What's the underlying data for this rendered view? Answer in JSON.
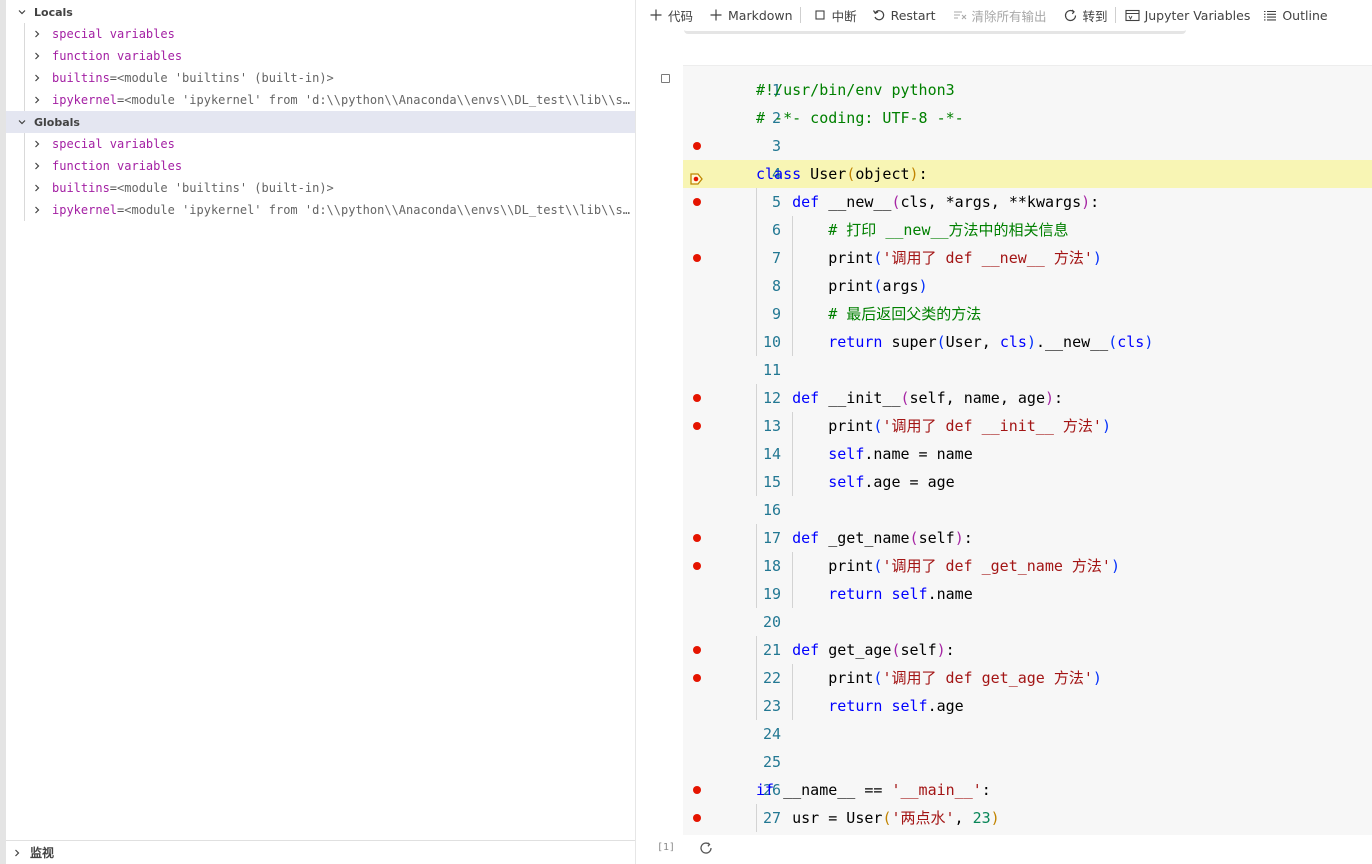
{
  "variables_panel": {
    "locals": {
      "title": "Locals",
      "items": [
        {
          "name": "special variables",
          "eq": "",
          "value": ""
        },
        {
          "name": "function variables",
          "eq": "",
          "value": ""
        },
        {
          "name": "builtins",
          "eq": " = ",
          "value": "<module 'builtins' (built-in)>"
        },
        {
          "name": "ipykernel",
          "eq": " = ",
          "value": "<module 'ipykernel' from 'd:\\\\python\\\\Anaconda\\\\envs\\\\DL_test\\\\lib\\\\s..."
        }
      ]
    },
    "globals": {
      "title": "Globals",
      "items": [
        {
          "name": "special variables",
          "eq": "",
          "value": ""
        },
        {
          "name": "function variables",
          "eq": "",
          "value": ""
        },
        {
          "name": "builtins",
          "eq": " = ",
          "value": "<module 'builtins' (built-in)>"
        },
        {
          "name": "ipykernel",
          "eq": " = ",
          "value": "<module 'ipykernel' from 'd:\\\\python\\\\Anaconda\\\\envs\\\\DL_test\\\\lib\\\\s..."
        }
      ]
    },
    "watch_title": "监视"
  },
  "toolbar": {
    "code_label": "代码",
    "markdown_label": "Markdown",
    "interrupt_label": "中断",
    "restart_label": "Restart",
    "clear_outputs_label": "清除所有输出",
    "goto_label": "转到",
    "jupyter_variables_label": "Jupyter Variables",
    "outline_label": "Outline"
  },
  "cell": {
    "execution_count": "[1]",
    "current_line": 4,
    "breakpoint_lines": [
      3,
      5,
      7,
      12,
      13,
      17,
      18,
      21,
      22,
      26,
      27
    ],
    "lines": [
      {
        "n": "1"
      },
      {
        "n": "2"
      },
      {
        "n": "3"
      },
      {
        "n": "4"
      },
      {
        "n": "5"
      },
      {
        "n": "6"
      },
      {
        "n": "7"
      },
      {
        "n": "8"
      },
      {
        "n": "9"
      },
      {
        "n": "10"
      },
      {
        "n": "11"
      },
      {
        "n": "12"
      },
      {
        "n": "13"
      },
      {
        "n": "14"
      },
      {
        "n": "15"
      },
      {
        "n": "16"
      },
      {
        "n": "17"
      },
      {
        "n": "18"
      },
      {
        "n": "19"
      },
      {
        "n": "20"
      },
      {
        "n": "21"
      },
      {
        "n": "22"
      },
      {
        "n": "23"
      },
      {
        "n": "24"
      },
      {
        "n": "25"
      },
      {
        "n": "26"
      },
      {
        "n": "27"
      }
    ],
    "code": [
      [
        [
          "com",
          "#!/usr/bin/env python3"
        ]
      ],
      [
        [
          "com",
          "# -*- coding: UTF-8 -*-"
        ]
      ],
      [],
      [
        [
          "kw",
          "class"
        ],
        [
          "plain",
          " User"
        ],
        [
          "bracket",
          "("
        ],
        [
          "plain",
          "object"
        ],
        [
          "bracket",
          ")"
        ],
        [
          "plain",
          ":"
        ]
      ],
      [
        [
          "plain",
          "    "
        ],
        [
          "kw",
          "def"
        ],
        [
          "plain",
          " __new__"
        ],
        [
          "bracket2",
          "("
        ],
        [
          "plain",
          "cls, *args, **kwargs"
        ],
        [
          "bracket2",
          ")"
        ],
        [
          "plain",
          ":"
        ]
      ],
      [
        [
          "plain",
          "        "
        ],
        [
          "com",
          "# 打印 __new__方法中的相关信息"
        ]
      ],
      [
        [
          "plain",
          "        print"
        ],
        [
          "bracket3",
          "("
        ],
        [
          "str",
          "'调用了 def __new__ 方法'"
        ],
        [
          "bracket3",
          ")"
        ]
      ],
      [
        [
          "plain",
          "        print"
        ],
        [
          "bracket3",
          "("
        ],
        [
          "plain",
          "args"
        ],
        [
          "bracket3",
          ")"
        ]
      ],
      [
        [
          "plain",
          "        "
        ],
        [
          "com",
          "# 最后返回父类的方法"
        ]
      ],
      [
        [
          "plain",
          "        "
        ],
        [
          "kw",
          "return"
        ],
        [
          "plain",
          " super"
        ],
        [
          "bracket3",
          "("
        ],
        [
          "plain",
          "User, "
        ],
        [
          "self",
          "cls"
        ],
        [
          "bracket3",
          ")"
        ],
        [
          "plain",
          ".__new__"
        ],
        [
          "bracket3",
          "("
        ],
        [
          "self",
          "cls"
        ],
        [
          "bracket3",
          ")"
        ]
      ],
      [],
      [
        [
          "plain",
          "    "
        ],
        [
          "kw",
          "def"
        ],
        [
          "plain",
          " __init__"
        ],
        [
          "bracket2",
          "("
        ],
        [
          "plain",
          "self, name, age"
        ],
        [
          "bracket2",
          ")"
        ],
        [
          "plain",
          ":"
        ]
      ],
      [
        [
          "plain",
          "        print"
        ],
        [
          "bracket3",
          "("
        ],
        [
          "str",
          "'调用了 def __init__ 方法'"
        ],
        [
          "bracket3",
          ")"
        ]
      ],
      [
        [
          "plain",
          "        "
        ],
        [
          "self",
          "self"
        ],
        [
          "plain",
          ".name = name"
        ]
      ],
      [
        [
          "plain",
          "        "
        ],
        [
          "self",
          "self"
        ],
        [
          "plain",
          ".age = age"
        ]
      ],
      [],
      [
        [
          "plain",
          "    "
        ],
        [
          "kw",
          "def"
        ],
        [
          "plain",
          " _get_name"
        ],
        [
          "bracket2",
          "("
        ],
        [
          "plain",
          "self"
        ],
        [
          "bracket2",
          ")"
        ],
        [
          "plain",
          ":"
        ]
      ],
      [
        [
          "plain",
          "        print"
        ],
        [
          "bracket3",
          "("
        ],
        [
          "str",
          "'调用了 def _get_name 方法'"
        ],
        [
          "bracket3",
          ")"
        ]
      ],
      [
        [
          "plain",
          "        "
        ],
        [
          "kw",
          "return"
        ],
        [
          "plain",
          " "
        ],
        [
          "self",
          "self"
        ],
        [
          "plain",
          ".name"
        ]
      ],
      [],
      [
        [
          "plain",
          "    "
        ],
        [
          "kw",
          "def"
        ],
        [
          "plain",
          " get_age"
        ],
        [
          "bracket2",
          "("
        ],
        [
          "plain",
          "self"
        ],
        [
          "bracket2",
          ")"
        ],
        [
          "plain",
          ":"
        ]
      ],
      [
        [
          "plain",
          "        print"
        ],
        [
          "bracket3",
          "("
        ],
        [
          "str",
          "'调用了 def get_age 方法'"
        ],
        [
          "bracket3",
          ")"
        ]
      ],
      [
        [
          "plain",
          "        "
        ],
        [
          "kw",
          "return"
        ],
        [
          "plain",
          " "
        ],
        [
          "self",
          "self"
        ],
        [
          "plain",
          ".age"
        ]
      ],
      [],
      [],
      [
        [
          "kw",
          "if"
        ],
        [
          "plain",
          " __name__ == "
        ],
        [
          "str",
          "'__main__'"
        ],
        [
          "plain",
          ":"
        ]
      ],
      [
        [
          "plain",
          "    usr = User"
        ],
        [
          "bracket",
          "("
        ],
        [
          "str",
          "'两点水'"
        ],
        [
          "plain",
          ", "
        ],
        [
          "num",
          "23"
        ],
        [
          "bracket",
          ")"
        ]
      ]
    ]
  },
  "colors": {
    "breakpoint": "#e51400",
    "current_line_bg": "#f8f5b4",
    "line_number": "#237893",
    "keyword": "#0000ff",
    "string": "#a31515",
    "comment": "#008000",
    "variable_name": "#a31fa3"
  }
}
